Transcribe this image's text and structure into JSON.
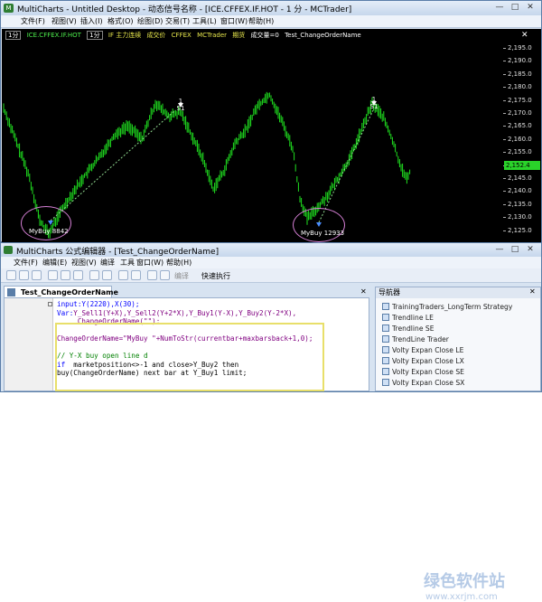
{
  "app": {
    "logo": "M",
    "title": "MultiCharts - Untitled Desktop - 动态信号名称 - [ICE.CFFEX.IF.HOT - 1 分 - MCTrader]",
    "window_controls": [
      "—",
      "□",
      "✕"
    ],
    "menu": [
      "文件(F)",
      "视图(V)",
      "插入(I)",
      "格式(O)",
      "绘图(D)",
      "交易(T)",
      "工具(L)",
      "窗口(W)",
      "帮助(H)"
    ]
  },
  "chart": {
    "info": {
      "left_tag": "1分",
      "symbol": "ICE.CFFEX.IF.HOT",
      "period": "1分",
      "contract": "IF 主力连续",
      "status": "成交价",
      "exchange": "CFFEX",
      "trader": "MCTrader",
      "extra": "期货",
      "position": "成交量=0",
      "strategy": "Test_ChangeOrderName"
    },
    "price_levels": [
      "2,195.0",
      "2,190.0",
      "2,185.0",
      "2,180.0",
      "2,175.0",
      "2,170.0",
      "2,165.0",
      "2,160.0",
      "2,155.0",
      "2,150.0",
      "2,145.0",
      "2,140.0",
      "2,135.0",
      "2,130.0",
      "2,125.0"
    ],
    "current_price": "2,152.4",
    "trades": [
      {
        "label": "MyBuy 8842"
      },
      {
        "label": "MyBuy 12933"
      }
    ],
    "exits": [
      {
        "count": "1",
        "label": "S1"
      },
      {
        "count": "1",
        "label": "S1"
      }
    ],
    "colors": {
      "candles": "#1fe01f",
      "background": "#000000",
      "trade_line": "#8fd88f",
      "ellipse": "#d47fd4"
    }
  },
  "editor": {
    "title": "MultiCharts 公式编辑器 - [Test_ChangeOrderName]",
    "window_controls": [
      "—",
      "□",
      "✕"
    ],
    "menu": [
      "文件(F)",
      "编辑(E)",
      "视图(V)",
      "编译",
      "工具",
      "窗口(W)",
      "帮助(H)"
    ],
    "toolbar": {
      "compile_label": "编译",
      "quick_run_label": "快速执行"
    },
    "tab": "Test_ChangeOrderName",
    "code": {
      "line1": {
        "pre": "input:Y(2220),X(30);"
      },
      "line2": {
        "kw": "Var:",
        "rest": "Y_Sell1(Y+X),Y_Sell2(Y+2*X),Y_Buy1(Y-X),Y_Buy2(Y-2*X),"
      },
      "line3": {
        "rest": "     ChangeOrderName(\"\");"
      },
      "line5": {
        "rest": "ChangeOrderName=\"MyBuy \"+NumToStr(currentbar+maxbarsback+1,0);"
      },
      "line7": {
        "cm": "// Y-X buy open line d"
      },
      "line8": {
        "kw": "if",
        "rest": "  marketposition<>-1 and close>Y_Buy2 then"
      },
      "line9": {
        "rest": "buy(ChangeOrderName) next bar at Y_Buy1 limit;"
      }
    },
    "navigator": {
      "title": "导航器",
      "items": [
        "TrainingTraders_LongTerm Strategy",
        "Trendline LE",
        "Trendline SE",
        "TrendLine Trader",
        "Volty Expan Close LE",
        "Volty Expan Close LX",
        "Volty Expan Close SE",
        "Volty Expan Close SX"
      ]
    }
  },
  "watermark": {
    "main": "绿色软件站",
    "sub": "www.xxrjm.com"
  }
}
